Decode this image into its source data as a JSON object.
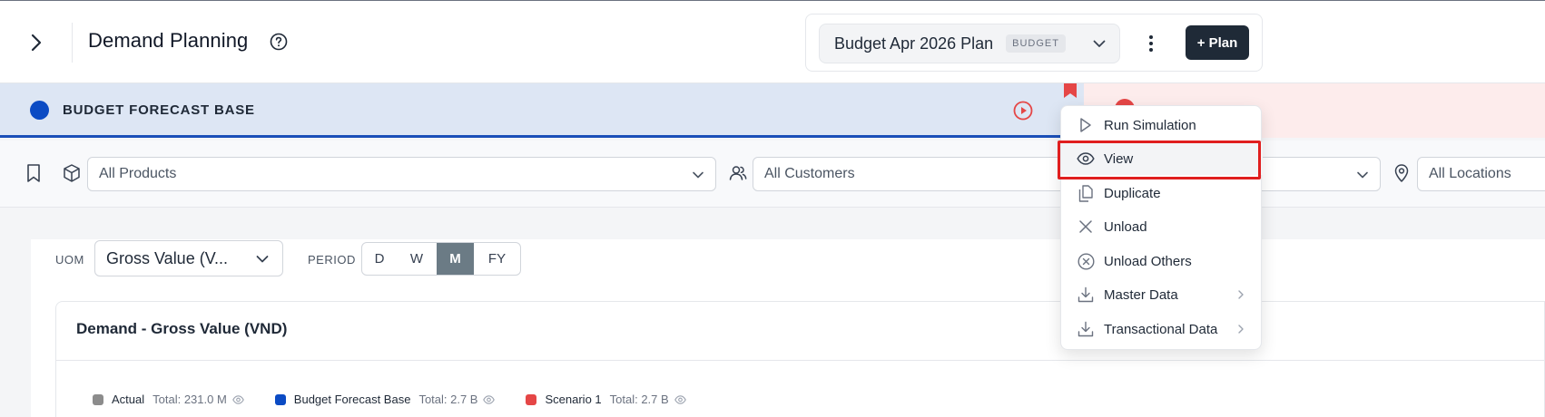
{
  "header": {
    "title": "Demand Planning",
    "plan_name": "Budget Apr 2026 Plan",
    "plan_badge": "BUDGET",
    "add_plan_label": "+ Plan"
  },
  "scenarios": {
    "active_label": "BUDGET FORECAST BASE",
    "active_color": "#0b4bc4",
    "second_color": "#e54646"
  },
  "filters": {
    "products": "All Products",
    "customers": "All Customers",
    "locations": "All Locations"
  },
  "controls": {
    "uom_label": "UOM",
    "uom_value": "Gross Value (V...",
    "period_label": "PERIOD",
    "periods": [
      "D",
      "W",
      "M",
      "FY"
    ],
    "active_period": "M"
  },
  "chart": {
    "title": "Demand - Gross Value (VND)",
    "legend": [
      {
        "name": "Actual",
        "total": "Total: 231.0 M",
        "color": "#8c8c8c"
      },
      {
        "name": "Budget Forecast Base",
        "total": "Total: 2.7 B",
        "color": "#0b4bc4"
      },
      {
        "name": "Scenario 1",
        "total": "Total: 2.7 B",
        "color": "#e54646"
      }
    ]
  },
  "context_menu": {
    "items": [
      {
        "label": "Run Simulation",
        "icon": "play-outline-icon"
      },
      {
        "label": "View",
        "icon": "eye-icon"
      },
      {
        "label": "Duplicate",
        "icon": "duplicate-icon"
      },
      {
        "label": "Unload",
        "icon": "close-icon"
      },
      {
        "label": "Unload Others",
        "icon": "close-circle-icon"
      },
      {
        "label": "Master Data",
        "icon": "download-icon",
        "submenu": true
      },
      {
        "label": "Transactional Data",
        "icon": "download-icon",
        "submenu": true
      }
    ],
    "highlighted": "View"
  }
}
